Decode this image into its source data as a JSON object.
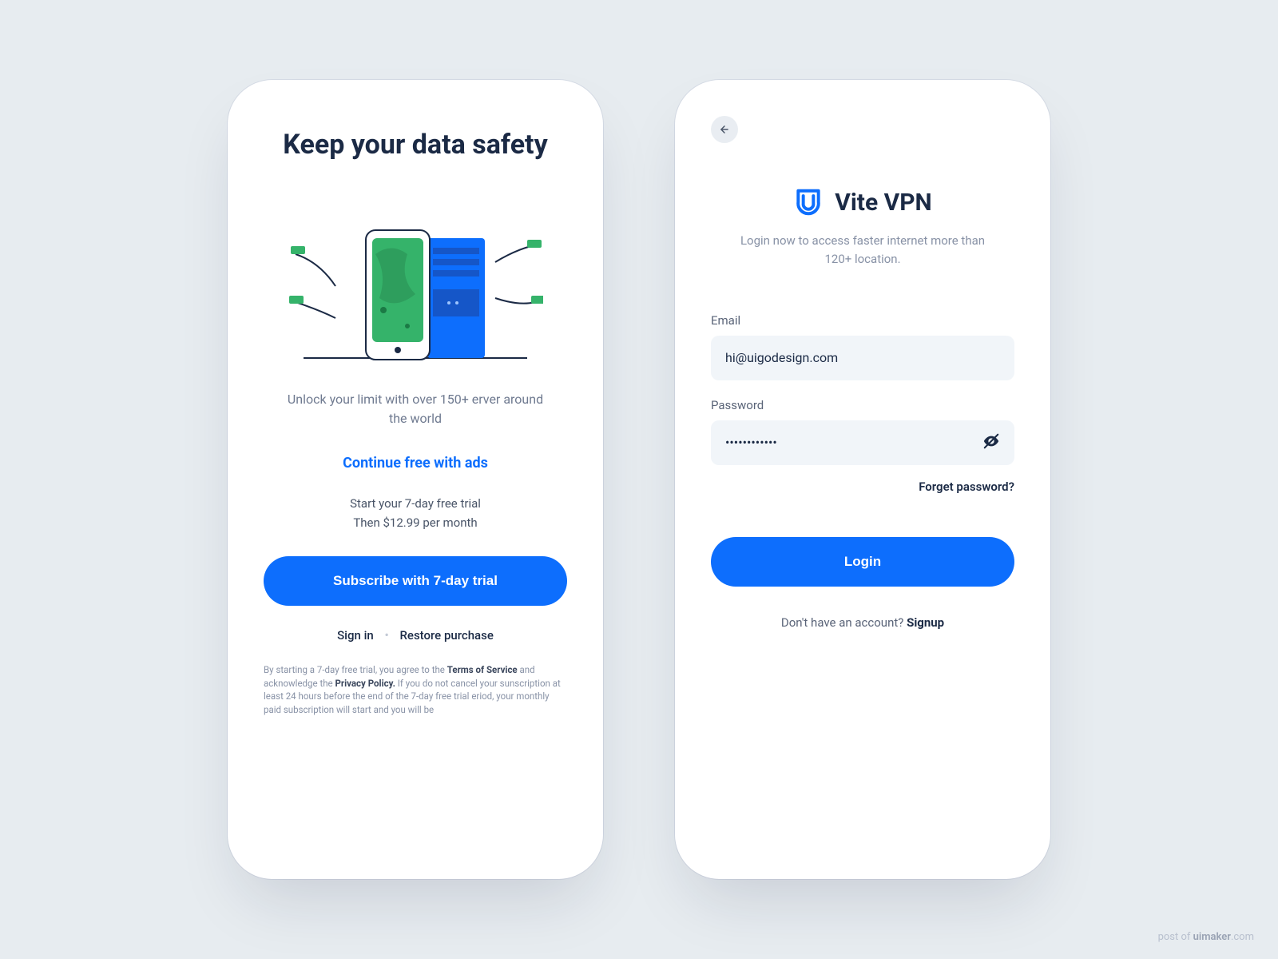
{
  "colors": {
    "primary": "#0d6efd",
    "navy": "#1b2a45",
    "muted": "#8892a6",
    "field_bg": "#f1f5f9",
    "page_bg": "#e7ecf0"
  },
  "screen1": {
    "title": "Keep your data safety",
    "subtitle": "Unlock your limit with over 150+ erver around the world",
    "continue_link": "Continue free with ads",
    "trial_line1": "Start your 7-day free trial",
    "trial_line2": "Then $12.99 per month",
    "subscribe_button": "Subscribe with 7-day trial",
    "signin_link": "Sign in",
    "restore_link": "Restore purchase",
    "legal_prefix": "By starting a 7-day free trial, you agree to the ",
    "legal_tos": "Terms of Service",
    "legal_mid1": " and acknowledge the ",
    "legal_pp": "Privacy Policy.",
    "legal_tail": " If you do not cancel your sunscription at least 24 hours before the end of the 7-day free trial eriod, your monthly paid subscription will start and you will be"
  },
  "screen2": {
    "app_name": "Vite VPN",
    "subtitle": "Login now to access faster internet more than 120+ location.",
    "email_label": "Email",
    "email_value": "hi@uigodesign.com",
    "password_label": "Password",
    "password_masked": "************",
    "forgot_link": "Forget password?",
    "login_button": "Login",
    "signup_prefix": "Don't have an account? ",
    "signup_link": "Signup"
  },
  "watermark": {
    "prefix": "post of ",
    "brand": "uimaker",
    "suffix": ".com"
  }
}
